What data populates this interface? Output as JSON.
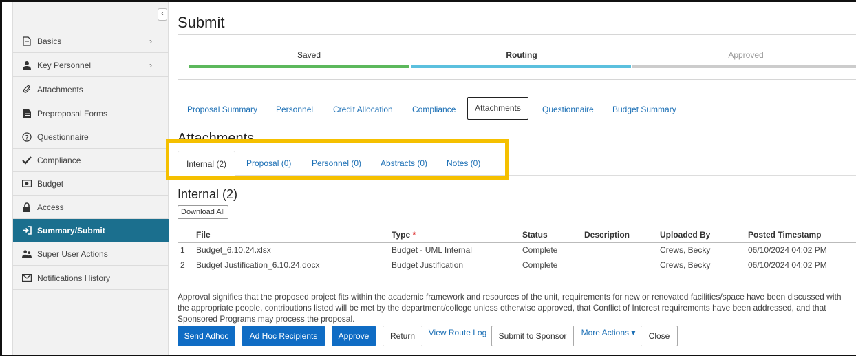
{
  "sidebar": {
    "collapse_glyph": "‹",
    "items": [
      {
        "label": "Basics",
        "icon": "document-icon",
        "chevron": "›"
      },
      {
        "label": "Key Personnel",
        "icon": "person-icon",
        "chevron": "›"
      },
      {
        "label": "Attachments",
        "icon": "paperclip-icon"
      },
      {
        "label": "Preproposal Forms",
        "icon": "file-icon"
      },
      {
        "label": "Questionnaire",
        "icon": "question-icon"
      },
      {
        "label": "Compliance",
        "icon": "check-icon"
      },
      {
        "label": "Budget",
        "icon": "money-icon"
      },
      {
        "label": "Access",
        "icon": "lock-icon"
      },
      {
        "label": "Summary/Submit",
        "icon": "sign-in-icon",
        "active": true
      },
      {
        "label": "Super User Actions",
        "icon": "users-icon"
      },
      {
        "label": "Notifications History",
        "icon": "envelope-icon"
      }
    ]
  },
  "header": {
    "title": "Submit"
  },
  "progress": {
    "steps": [
      {
        "label": "Saved",
        "color": "#5cb85c"
      },
      {
        "label": "Routing",
        "color": "#5bc0de"
      },
      {
        "label": "Approved",
        "color": "#cccccc"
      }
    ]
  },
  "top_tabs": [
    "Proposal Summary",
    "Personnel",
    "Credit Allocation",
    "Compliance",
    "Attachments",
    "Questionnaire",
    "Budget Summary"
  ],
  "section": {
    "title": "Attachments"
  },
  "sub_tabs": [
    "Internal (2)",
    "Proposal (0)",
    "Personnel (0)",
    "Abstracts (0)",
    "Notes (0)"
  ],
  "internal": {
    "title": "Internal (2)",
    "download_label": "Download All",
    "columns": [
      "File",
      "Type",
      "Status",
      "Description",
      "Uploaded By",
      "Posted Timestamp"
    ],
    "required_marker": "*",
    "rows": [
      {
        "num": "1",
        "file": "Budget_6.10.24.xlsx",
        "type": "Budget - UML Internal",
        "status": "Complete",
        "description": "",
        "uploaded_by": "Crews, Becky",
        "timestamp": "06/10/2024 04:02 PM"
      },
      {
        "num": "2",
        "file": "Budget Justification_6.10.24.docx",
        "type": "Budget Justification",
        "status": "Complete",
        "description": "",
        "uploaded_by": "Crews, Becky",
        "timestamp": "06/10/2024 04:02 PM"
      }
    ]
  },
  "note": "Approval signifies that the proposed project fits within the academic framework and resources of the unit, requirements for new or renovated facilities/space have been discussed with the appropriate people, contributions listed will be met by the department/college unless otherwise approved, that Conflict of Interest requirements have been addressed, and that Sponsored Programs may process the proposal.",
  "actions": {
    "send_adhoc": "Send Adhoc",
    "ad_hoc_recipients": "Ad Hoc Recipients",
    "approve": "Approve",
    "return": "Return",
    "view_route_log": "View Route Log",
    "submit_to_sponsor": "Submit to Sponsor",
    "more_actions": "More Actions ▾",
    "close": "Close"
  }
}
